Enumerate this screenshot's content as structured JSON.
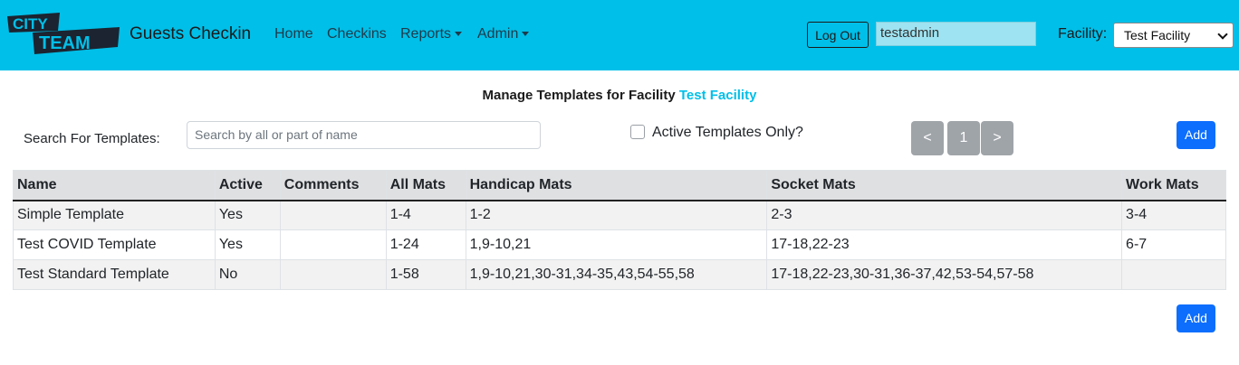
{
  "navbar": {
    "logo_line1": "CITY",
    "logo_line2": "TEAM",
    "brand": "Guests Checkin",
    "links": {
      "home": "Home",
      "checkins": "Checkins",
      "reports": "Reports",
      "admin": "Admin"
    },
    "logout_label": "Log Out",
    "username": "testadmin",
    "facility_label": "Facility:",
    "facility_selected": "Test Facility"
  },
  "page": {
    "title_prefix": "Manage Templates for Facility",
    "title_facility": "Test Facility"
  },
  "search": {
    "label": "Search For Templates:",
    "placeholder": "Search by all or part of name",
    "active_only_label": "Active Templates Only?",
    "active_only_checked": false
  },
  "pagination": {
    "prev": "<",
    "current": "1",
    "next": ">"
  },
  "add_label": "Add",
  "table": {
    "columns": [
      "Name",
      "Active",
      "Comments",
      "All Mats",
      "Handicap Mats",
      "Socket Mats",
      "Work Mats"
    ],
    "rows": [
      [
        "Simple Template",
        "Yes",
        "",
        "1-4",
        "1-2",
        "2-3",
        "3-4"
      ],
      [
        "Test COVID Template",
        "Yes",
        "",
        "1-24",
        "1,9-10,21",
        "17-18,22-23",
        "6-7"
      ],
      [
        "Test Standard Template",
        "No",
        "",
        "1-58",
        "1,9-10,21,30-31,34-35,43,54-55,58",
        "17-18,22-23,30-31,36-37,42,53-54,57-58",
        ""
      ]
    ]
  },
  "colors": {
    "navbar_bg": "#00bfe8",
    "accent": "#00bfe8",
    "primary_button": "#0d6efd",
    "secondary_button": "#9fa4a9"
  }
}
